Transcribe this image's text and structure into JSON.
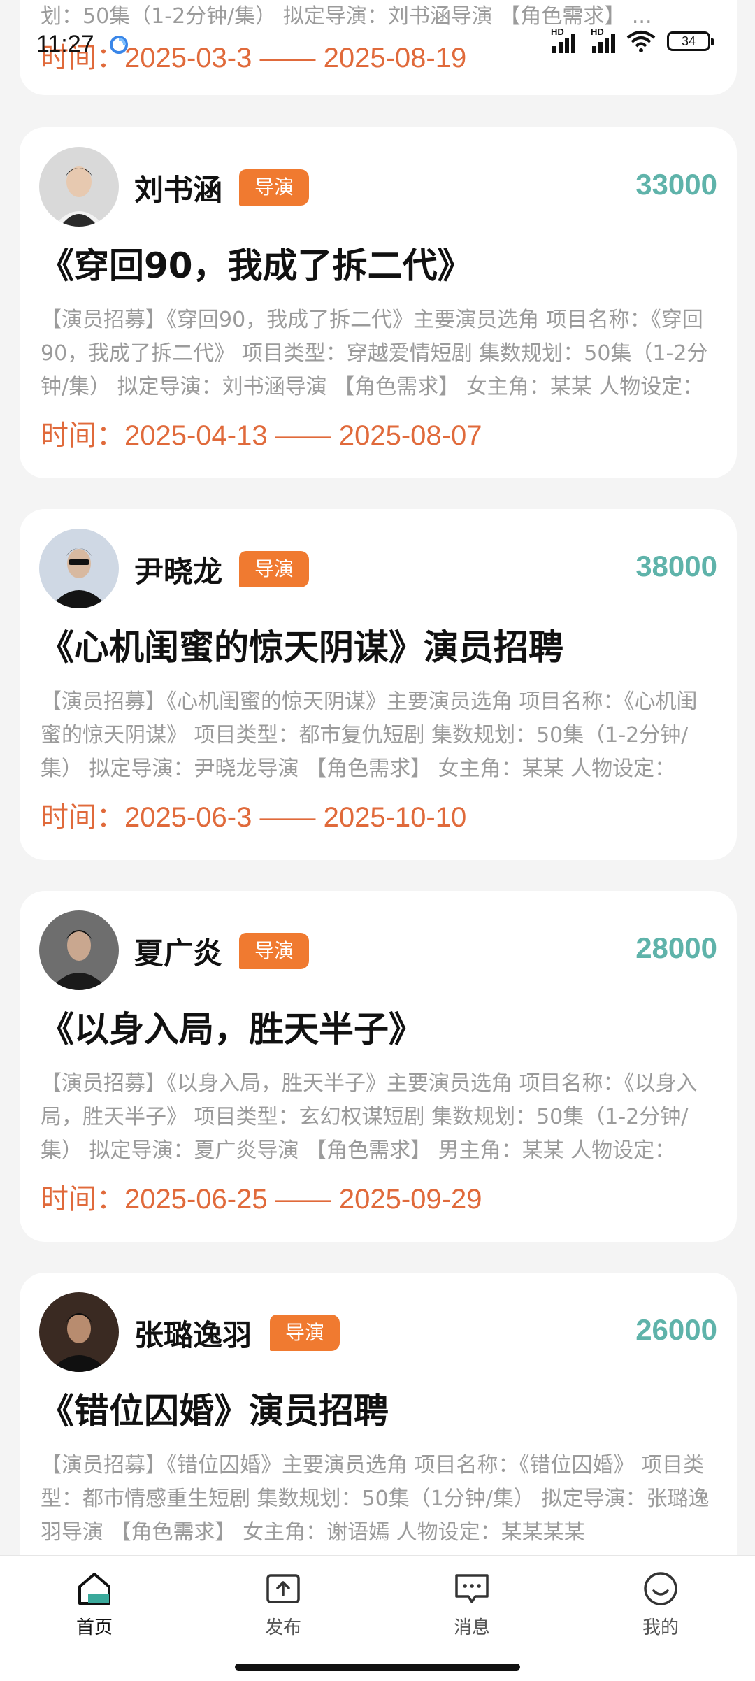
{
  "status_bar": {
    "time": "11:27",
    "battery": "34"
  },
  "top_card": {
    "desc": "划：50集（1-2分钟/集） 拟定导演：刘书涵导演 【角色需求】 ...",
    "time": "时间：2025-03-3 —— 2025-08-19"
  },
  "cards": [
    {
      "name": "刘书涵",
      "role": "导演",
      "budget": "33000",
      "title": "《穿回90，我成了拆二代》",
      "desc": "【演员招募】《穿回90，我成了拆二代》主要演员选角 项目名称：《穿回90，我成了拆二代》 项目类型：穿越爱情短剧 集数规划：50集（1-2分钟/集） 拟定导演：刘书涵导演 【角色需求】 女主角：某某 人物设定：",
      "time": "时间：2025-04-13 —— 2025-08-07"
    },
    {
      "name": "尹晓龙",
      "role": "导演",
      "budget": "38000",
      "title": "《心机闺蜜的惊天阴谋》演员招聘",
      "desc": "【演员招募】《心机闺蜜的惊天阴谋》主要演员选角 项目名称：《心机闺蜜的惊天阴谋》 项目类型：都市复仇短剧 集数规划：50集（1-2分钟/集） 拟定导演：尹晓龙导演 【角色需求】 女主角：某某 人物设定：",
      "time": "时间：2025-06-3 —— 2025-10-10"
    },
    {
      "name": "夏广炎",
      "role": "导演",
      "budget": "28000",
      "title": "《以身入局，胜天半子》",
      "desc": "【演员招募】《以身入局，胜天半子》主要演员选角 项目名称：《以身入局，胜天半子》 项目类型：玄幻权谋短剧 集数规划：50集（1-2分钟/集） 拟定导演：夏广炎导演 【角色需求】 男主角：某某 人物设定：",
      "time": "时间：2025-06-25 —— 2025-09-29"
    },
    {
      "name": "张璐逸羽",
      "role": "导演",
      "budget": "26000",
      "title": "《错位囚婚》演员招聘",
      "desc": "【演员招募】《错位囚婚》主要演员选角 项目名称：《错位囚婚》 项目类型：都市情感重生短剧 集数规划：50集（1分钟/集） 拟定导演：张璐逸羽导演 【角色需求】 女主角：谢语嫣 人物设定：某某某某",
      "time": ""
    }
  ],
  "nav": {
    "home": "首页",
    "publish": "发布",
    "messages": "消息",
    "mine": "我的"
  },
  "colors": {
    "accent": "#f07a30",
    "budget": "#5fb3aa",
    "time": "#e06a3b"
  }
}
